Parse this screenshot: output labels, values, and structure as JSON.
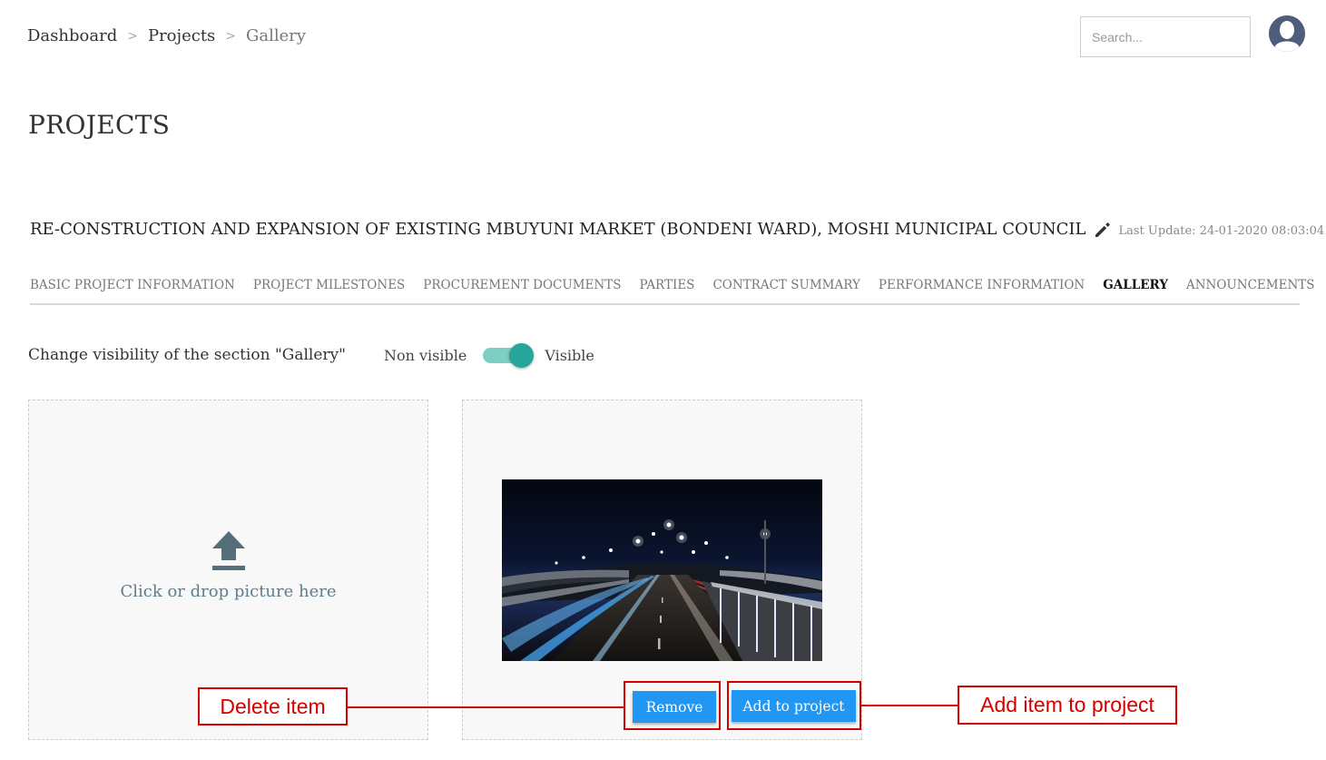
{
  "breadcrumb": {
    "items": [
      "Dashboard",
      "Projects"
    ],
    "separator": ">",
    "current": "Gallery"
  },
  "search": {
    "placeholder": "Search..."
  },
  "page": {
    "title": "PROJECTS"
  },
  "project": {
    "name": "RE-CONSTRUCTION AND EXPANSION OF EXISTING MBUYUNI MARKET (BONDENI WARD), MOSHI MUNICIPAL COUNCIL",
    "last_update": "Last Update: 24-01-2020 08:03:04"
  },
  "tabs": [
    {
      "label": "BASIC PROJECT INFORMATION",
      "active": false
    },
    {
      "label": "PROJECT MILESTONES",
      "active": false
    },
    {
      "label": "PROCUREMENT DOCUMENTS",
      "active": false
    },
    {
      "label": "PARTIES",
      "active": false
    },
    {
      "label": "CONTRACT SUMMARY",
      "active": false
    },
    {
      "label": "PERFORMANCE INFORMATION",
      "active": false
    },
    {
      "label": "GALLERY",
      "active": true
    },
    {
      "label": "ANNOUNCEMENTS",
      "active": false
    }
  ],
  "visibility": {
    "label": "Change visibility of the section \"Gallery\"",
    "off_label": "Non visible",
    "on_label": "Visible",
    "state": "Visible"
  },
  "upload": {
    "text": "Click or drop picture here",
    "icon": "upload-icon"
  },
  "gallery_item": {
    "image": "night-highway-photo",
    "remove_label": "Remove",
    "add_label": "Add to project"
  },
  "annotations": {
    "delete": "Delete item",
    "add": "Add item to project"
  },
  "colors": {
    "primary_button": "#2196f3",
    "toggle_knob": "#26a69a",
    "toggle_track": "#7ccfc2",
    "annotation": "#d40000",
    "upload_text": "#607d8b"
  }
}
